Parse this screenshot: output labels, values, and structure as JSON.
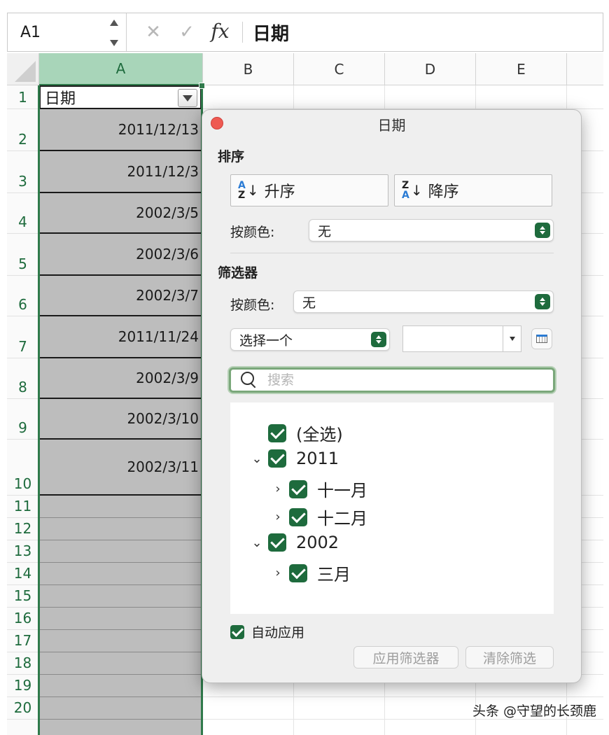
{
  "formula_bar": {
    "cell_ref": "A1",
    "cancel_icon": "✕",
    "confirm_icon": "✓",
    "fx_label": "fx",
    "value": "日期"
  },
  "columns": [
    "A",
    "B",
    "C",
    "D",
    "E"
  ],
  "rows": [
    "1",
    "2",
    "3",
    "4",
    "5",
    "6",
    "7",
    "8",
    "9",
    "10",
    "11",
    "12",
    "13",
    "14",
    "15",
    "16",
    "17",
    "18",
    "19",
    "20"
  ],
  "column_a": {
    "header_cell": "日期",
    "values": [
      "2011/12/13",
      "2011/12/3",
      "2002/3/5",
      "2002/3/6",
      "2002/3/7",
      "2011/11/24",
      "2002/3/9",
      "2002/3/10",
      "2002/3/11"
    ]
  },
  "filter_dialog": {
    "title": "日期",
    "sort_section": "排序",
    "ascending_label": "升序",
    "descending_label": "降序",
    "by_color_label": "按颜色:",
    "sort_color_value": "无",
    "filter_section": "筛选器",
    "filter_color_label": "按颜色:",
    "filter_color_value": "无",
    "condition_value": "选择一个",
    "condition_input": "",
    "search_placeholder": "搜索",
    "tree": {
      "select_all": "(全选)",
      "year_2011": "2011",
      "nov": "十一月",
      "dec": "十二月",
      "year_2002": "2002",
      "mar": "三月"
    },
    "auto_apply_label": "自动应用",
    "apply_button": "应用筛选器",
    "clear_button": "清除筛选"
  },
  "watermark": "头条 @守望的长颈鹿",
  "colors": {
    "accent_green": "#1e6b3d",
    "selected_header": "#a8d5b9",
    "selected_cells": "#bdbdbd",
    "close_button": "#ee5a52"
  }
}
